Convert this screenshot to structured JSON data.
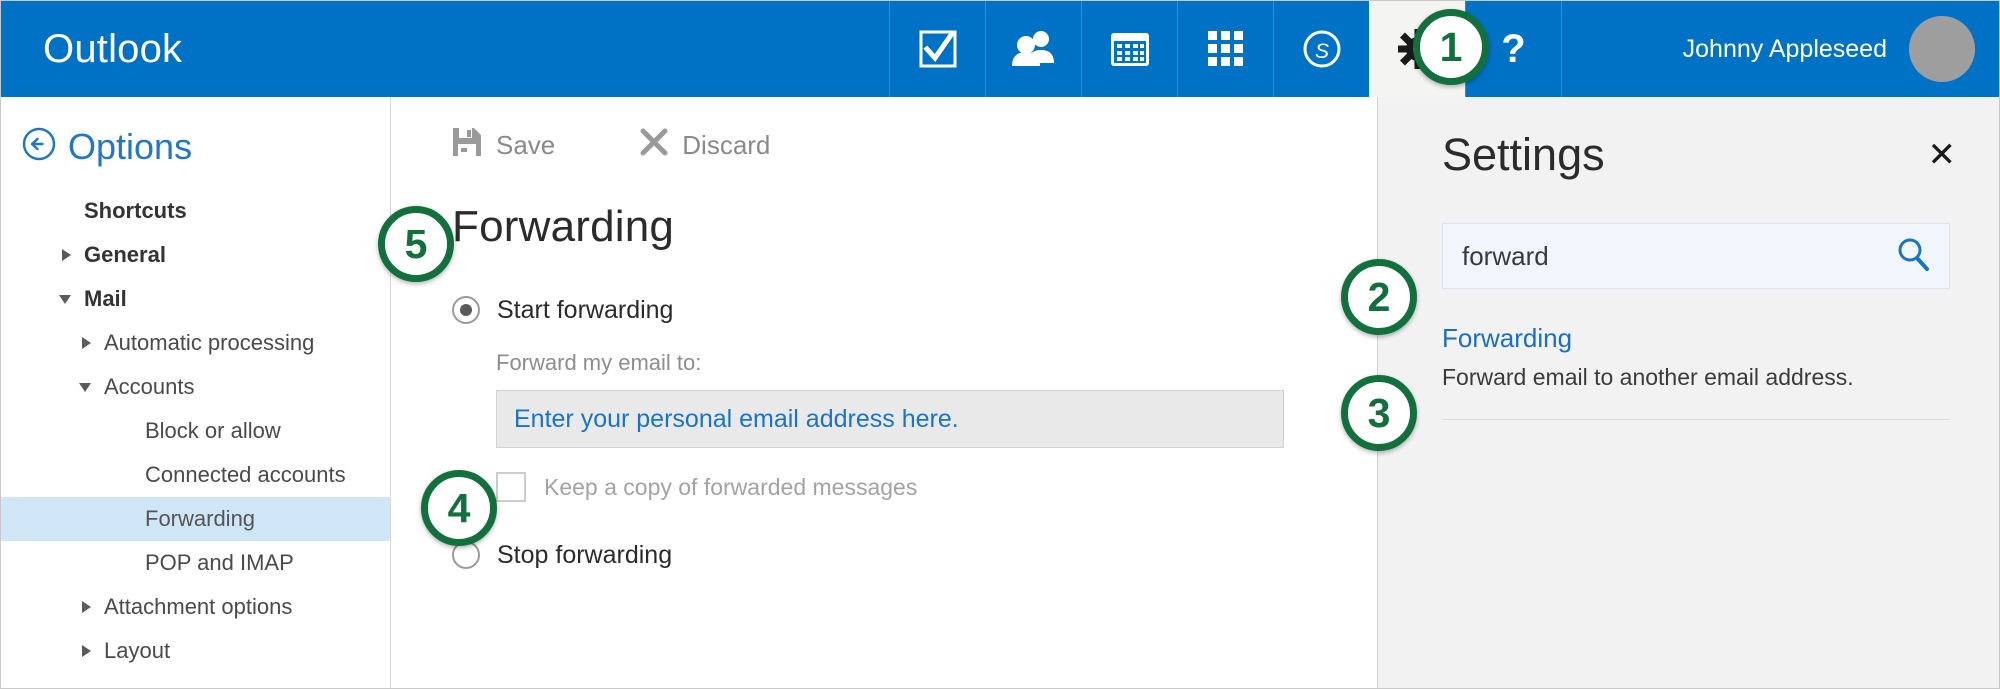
{
  "app": {
    "brand": "Outlook",
    "accent_blue": "#0072c6",
    "callout_green": "#12703c"
  },
  "topbar": {
    "icons": [
      {
        "name": "tasks-icon",
        "label": "Tasks"
      },
      {
        "name": "people-icon",
        "label": "People"
      },
      {
        "name": "calendar-icon",
        "label": "Calendar"
      },
      {
        "name": "app-launcher-icon",
        "label": "Apps"
      },
      {
        "name": "skype-icon",
        "label": "Skype"
      },
      {
        "name": "gear-icon",
        "label": "Settings"
      }
    ],
    "help_label": "?",
    "user_name": "Johnny Appleseed"
  },
  "leftnav": {
    "back_label": "Options",
    "items": [
      {
        "label": "Shortcuts",
        "level": 0,
        "caret": "none",
        "bold": true,
        "selected": false
      },
      {
        "label": "General",
        "level": 0,
        "caret": "collapsed",
        "bold": true,
        "selected": false
      },
      {
        "label": "Mail",
        "level": 0,
        "caret": "expanded",
        "bold": true,
        "selected": false
      },
      {
        "label": "Automatic processing",
        "level": 1,
        "caret": "collapsed",
        "bold": false,
        "selected": false
      },
      {
        "label": "Accounts",
        "level": 1,
        "caret": "expanded",
        "bold": false,
        "selected": false
      },
      {
        "label": "Block or allow",
        "level": 2,
        "caret": "none",
        "bold": false,
        "selected": false
      },
      {
        "label": "Connected accounts",
        "level": 2,
        "caret": "none",
        "bold": false,
        "selected": false
      },
      {
        "label": "Forwarding",
        "level": 2,
        "caret": "none",
        "bold": false,
        "selected": true
      },
      {
        "label": "POP and IMAP",
        "level": 2,
        "caret": "none",
        "bold": false,
        "selected": false
      },
      {
        "label": "Attachment options",
        "level": 1,
        "caret": "collapsed",
        "bold": false,
        "selected": false
      },
      {
        "label": "Layout",
        "level": 1,
        "caret": "collapsed",
        "bold": false,
        "selected": false
      }
    ]
  },
  "main": {
    "save_label": "Save",
    "discard_label": "Discard",
    "page_title": "Forwarding",
    "start_forwarding_label": "Start forwarding",
    "start_forwarding_selected": true,
    "forward_to_label": "Forward my email to:",
    "email_value": "Enter your personal email address here.",
    "keep_copy_label": "Keep a copy of forwarded messages",
    "keep_copy_checked": false,
    "stop_forwarding_label": "Stop forwarding",
    "stop_forwarding_selected": false
  },
  "settings_panel": {
    "title": "Settings",
    "close_label": "✕",
    "search_value": "forward",
    "results": [
      {
        "title": "Forwarding",
        "description": "Forward email to another email address."
      }
    ]
  },
  "callouts": [
    {
      "id": 1,
      "number": "1",
      "target": "gear-icon"
    },
    {
      "id": 2,
      "number": "2",
      "target": "settings-search-input"
    },
    {
      "id": 3,
      "number": "3",
      "target": "search-result-forwarding"
    },
    {
      "id": 4,
      "number": "4",
      "target": "forward-email-input"
    },
    {
      "id": 5,
      "number": "5",
      "target": "save-button"
    }
  ]
}
